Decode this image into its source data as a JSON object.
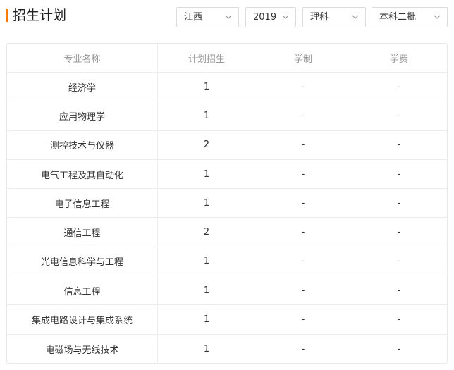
{
  "header": {
    "title": "招生计划"
  },
  "filters": [
    {
      "name": "province-select",
      "value": "江西"
    },
    {
      "name": "year-select",
      "value": "2019"
    },
    {
      "name": "subject-select",
      "value": "理科"
    },
    {
      "name": "batch-select",
      "value": "本科二批"
    }
  ],
  "table": {
    "columns": [
      "专业名称",
      "计划招生",
      "学制",
      "学费"
    ],
    "rows": [
      [
        "经济学",
        "1",
        "-",
        "-"
      ],
      [
        "应用物理学",
        "1",
        "-",
        "-"
      ],
      [
        "测控技术与仪器",
        "2",
        "-",
        "-"
      ],
      [
        "电气工程及其自动化",
        "1",
        "-",
        "-"
      ],
      [
        "电子信息工程",
        "1",
        "-",
        "-"
      ],
      [
        "通信工程",
        "2",
        "-",
        "-"
      ],
      [
        "光电信息科学与工程",
        "1",
        "-",
        "-"
      ],
      [
        "信息工程",
        "1",
        "-",
        "-"
      ],
      [
        "集成电路设计与集成系统",
        "1",
        "-",
        "-"
      ],
      [
        "电磁场与无线技术",
        "1",
        "-",
        "-"
      ]
    ]
  },
  "colors": {
    "accent": "#f57c00",
    "border": "#e8e8e8",
    "header_text": "#999999"
  },
  "icons": {
    "dropdown": "chevron-down-icon"
  }
}
